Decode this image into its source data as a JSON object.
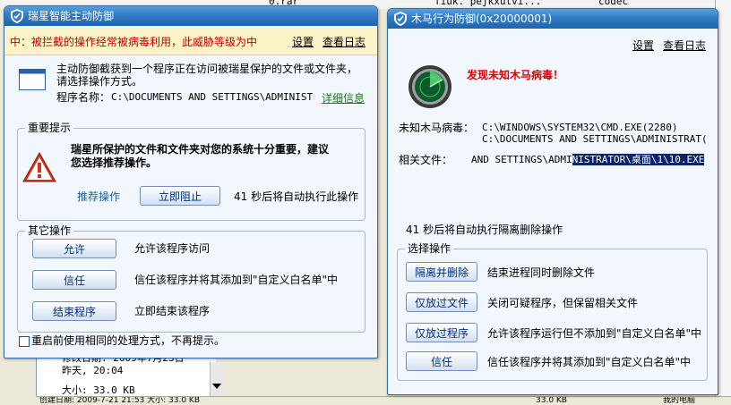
{
  "background": {
    "top_items": [
      "0.rar",
      "fiuk. pejkxutvi...",
      "codec"
    ],
    "file_info": {
      "modified_label": "修改日期: 2009年7月23日",
      "modified_time": "昨天, 20:04",
      "size_label": "大小: 33.0 KB"
    },
    "status_left": "创建日期: 2009-7-21 21:53  大小: 33.0 KB",
    "status_mid": "33.0 KB",
    "status_right": "我的电脑"
  },
  "dialog1": {
    "title": "瑞星智能主动防御",
    "alert": "中：被拦截的操作经常被病毒利用，此威胁等级为中",
    "settings": "设置",
    "view_log": "查看日志",
    "intro_line1": "主动防御截获到一个程序正在访问被瑞星保护的文件或文件夹，",
    "intro_line2": "请选择操作方式。",
    "program_label": "程序名称：",
    "program_value": "C:\\DOCUMENTS AND SETTINGS\\ADMINIST",
    "details_link": "详细信息",
    "important_group": "重要提示",
    "warning_line1": "瑞星所保护的文件和文件夹对您的系统十分重要，建议",
    "warning_line2": "您选择推荐操作。",
    "recommend_label": "推荐操作",
    "block_button": "立即阻止",
    "countdown": "41 秒后将自动执行此操作",
    "other_group": "其它操作",
    "allow_button": "允许",
    "allow_desc": "允许该程序访问",
    "trust_button": "信任",
    "trust_desc": "信任该程序并将其添加到\"自定义白名单\"中",
    "end_button": "结束程序",
    "end_desc": "立即结束该程序",
    "remember_label": "重启前使用相同的处理方式，不再提示。"
  },
  "dialog2": {
    "title": "木马行为防御(0x20000001)",
    "settings": "设置",
    "view_log": "查看日志",
    "alert_title": "发现未知木马病毒！",
    "trojan_label": "未知木马病毒：",
    "trojan_line1": "C:\\WINDOWS\\SYSTEM32\\CMD.EXE(2280)",
    "trojan_line2": "C:\\DOCUMENTS AND SETTINGS\\ADMINISTRAT(",
    "file_label": "相关文件：",
    "file_value_plain": "AND SETTINGS\\ADMI",
    "file_value_selected": "NISTRATOR\\桌面\\1\\10.EXE",
    "countdown": "41 秒后将自动执行隔离删除操作",
    "choose_group": "选择操作",
    "isolate_button": "隔离并删除",
    "isolate_desc": "结束进程同时删除文件",
    "release_file_button": "仅放过文件",
    "release_file_desc": "关闭可疑程序，但保留相关文件",
    "release_proc_button": "仅放过程序",
    "release_proc_desc": "允许该程序运行但不添加到\"自定义白名单\"中",
    "trust_button": "信任",
    "trust_desc": "信任该程序并将其添加到\"自定义白名单\"中"
  },
  "colors": {
    "titlebar": "#2f7cc5",
    "alert_bg": "#fdf3c8",
    "alert_text": "#c00000",
    "warning_red": "#d0341a",
    "highlight": "#0a246a"
  },
  "icons": [
    "shield-icon",
    "window-icon",
    "warning-icon",
    "radar-icon"
  ]
}
